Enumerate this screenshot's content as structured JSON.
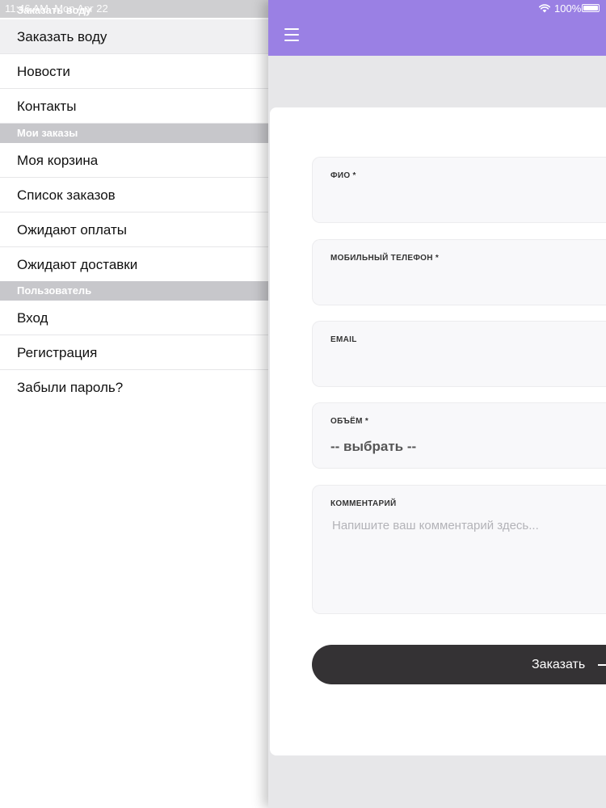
{
  "status_bar": {
    "time": "11:46 AM",
    "date": "Mon Apr 22",
    "battery": "100%"
  },
  "sidebar": {
    "header_label": "Заказать воду",
    "groups": [
      {
        "title": "",
        "items": [
          {
            "label": "Заказать воду",
            "active": true
          },
          {
            "label": "Новости",
            "active": false
          },
          {
            "label": "Контакты",
            "active": false
          }
        ]
      },
      {
        "title": "Мои заказы",
        "items": [
          {
            "label": "Моя корзина"
          },
          {
            "label": "Список заказов"
          },
          {
            "label": "Ожидают оплаты"
          },
          {
            "label": "Ожидают доставки"
          }
        ]
      },
      {
        "title": "Пользователь",
        "items": [
          {
            "label": "Вход"
          },
          {
            "label": "Регистрация"
          },
          {
            "label": "Забыли пароль?"
          }
        ]
      }
    ]
  },
  "header": {
    "accent_color": "#9a80e4",
    "menu_icon": "hamburger-icon"
  },
  "form": {
    "fields": [
      {
        "label": "ФИО *",
        "value": ""
      },
      {
        "label": "МОБИЛЬНЫЙ ТЕЛЕФОН *",
        "value": ""
      },
      {
        "label": "EMAIL",
        "value": ""
      },
      {
        "label": "ОБЪЁМ *",
        "value": "-- выбрать --"
      },
      {
        "label": "КОММЕНТАРИЙ",
        "placeholder": "Напишите ваш комментарий здесь..."
      }
    ],
    "submit_label": "Заказать",
    "submit_color": "#343234"
  }
}
